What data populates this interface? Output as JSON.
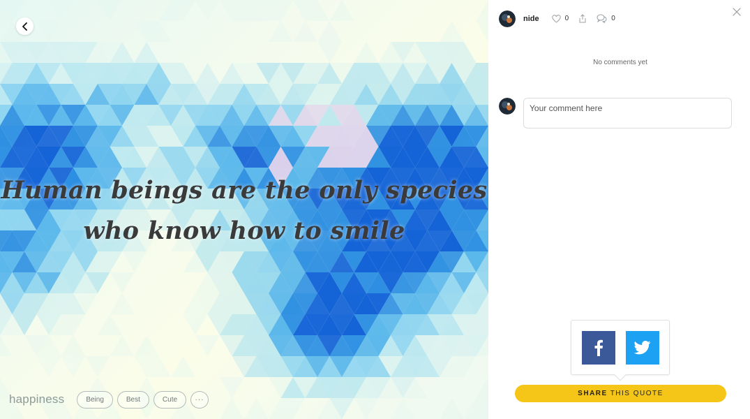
{
  "quote": {
    "line1": "Human beings are the only species",
    "line2": "who know how to smile"
  },
  "footer": {
    "category": "happiness",
    "tags": [
      "Being",
      "Best",
      "Cute"
    ],
    "more": "···"
  },
  "panel": {
    "author": "nide",
    "likes": "0",
    "comments_count": "0",
    "no_comments": "No comments yet",
    "comment_placeholder": "Your comment here"
  },
  "share": {
    "bold": "SHARE",
    "rest": "THIS QUOTE"
  },
  "icons": {
    "back": "chevron-left-icon",
    "close": "close-icon",
    "like": "heart-icon",
    "share": "share-icon",
    "comments": "speech-bubbles-icon",
    "facebook": "facebook-icon",
    "twitter": "twitter-icon"
  },
  "colors": {
    "facebook": "#3b5998",
    "twitter": "#1da1f2",
    "share_button": "#f5c518"
  }
}
